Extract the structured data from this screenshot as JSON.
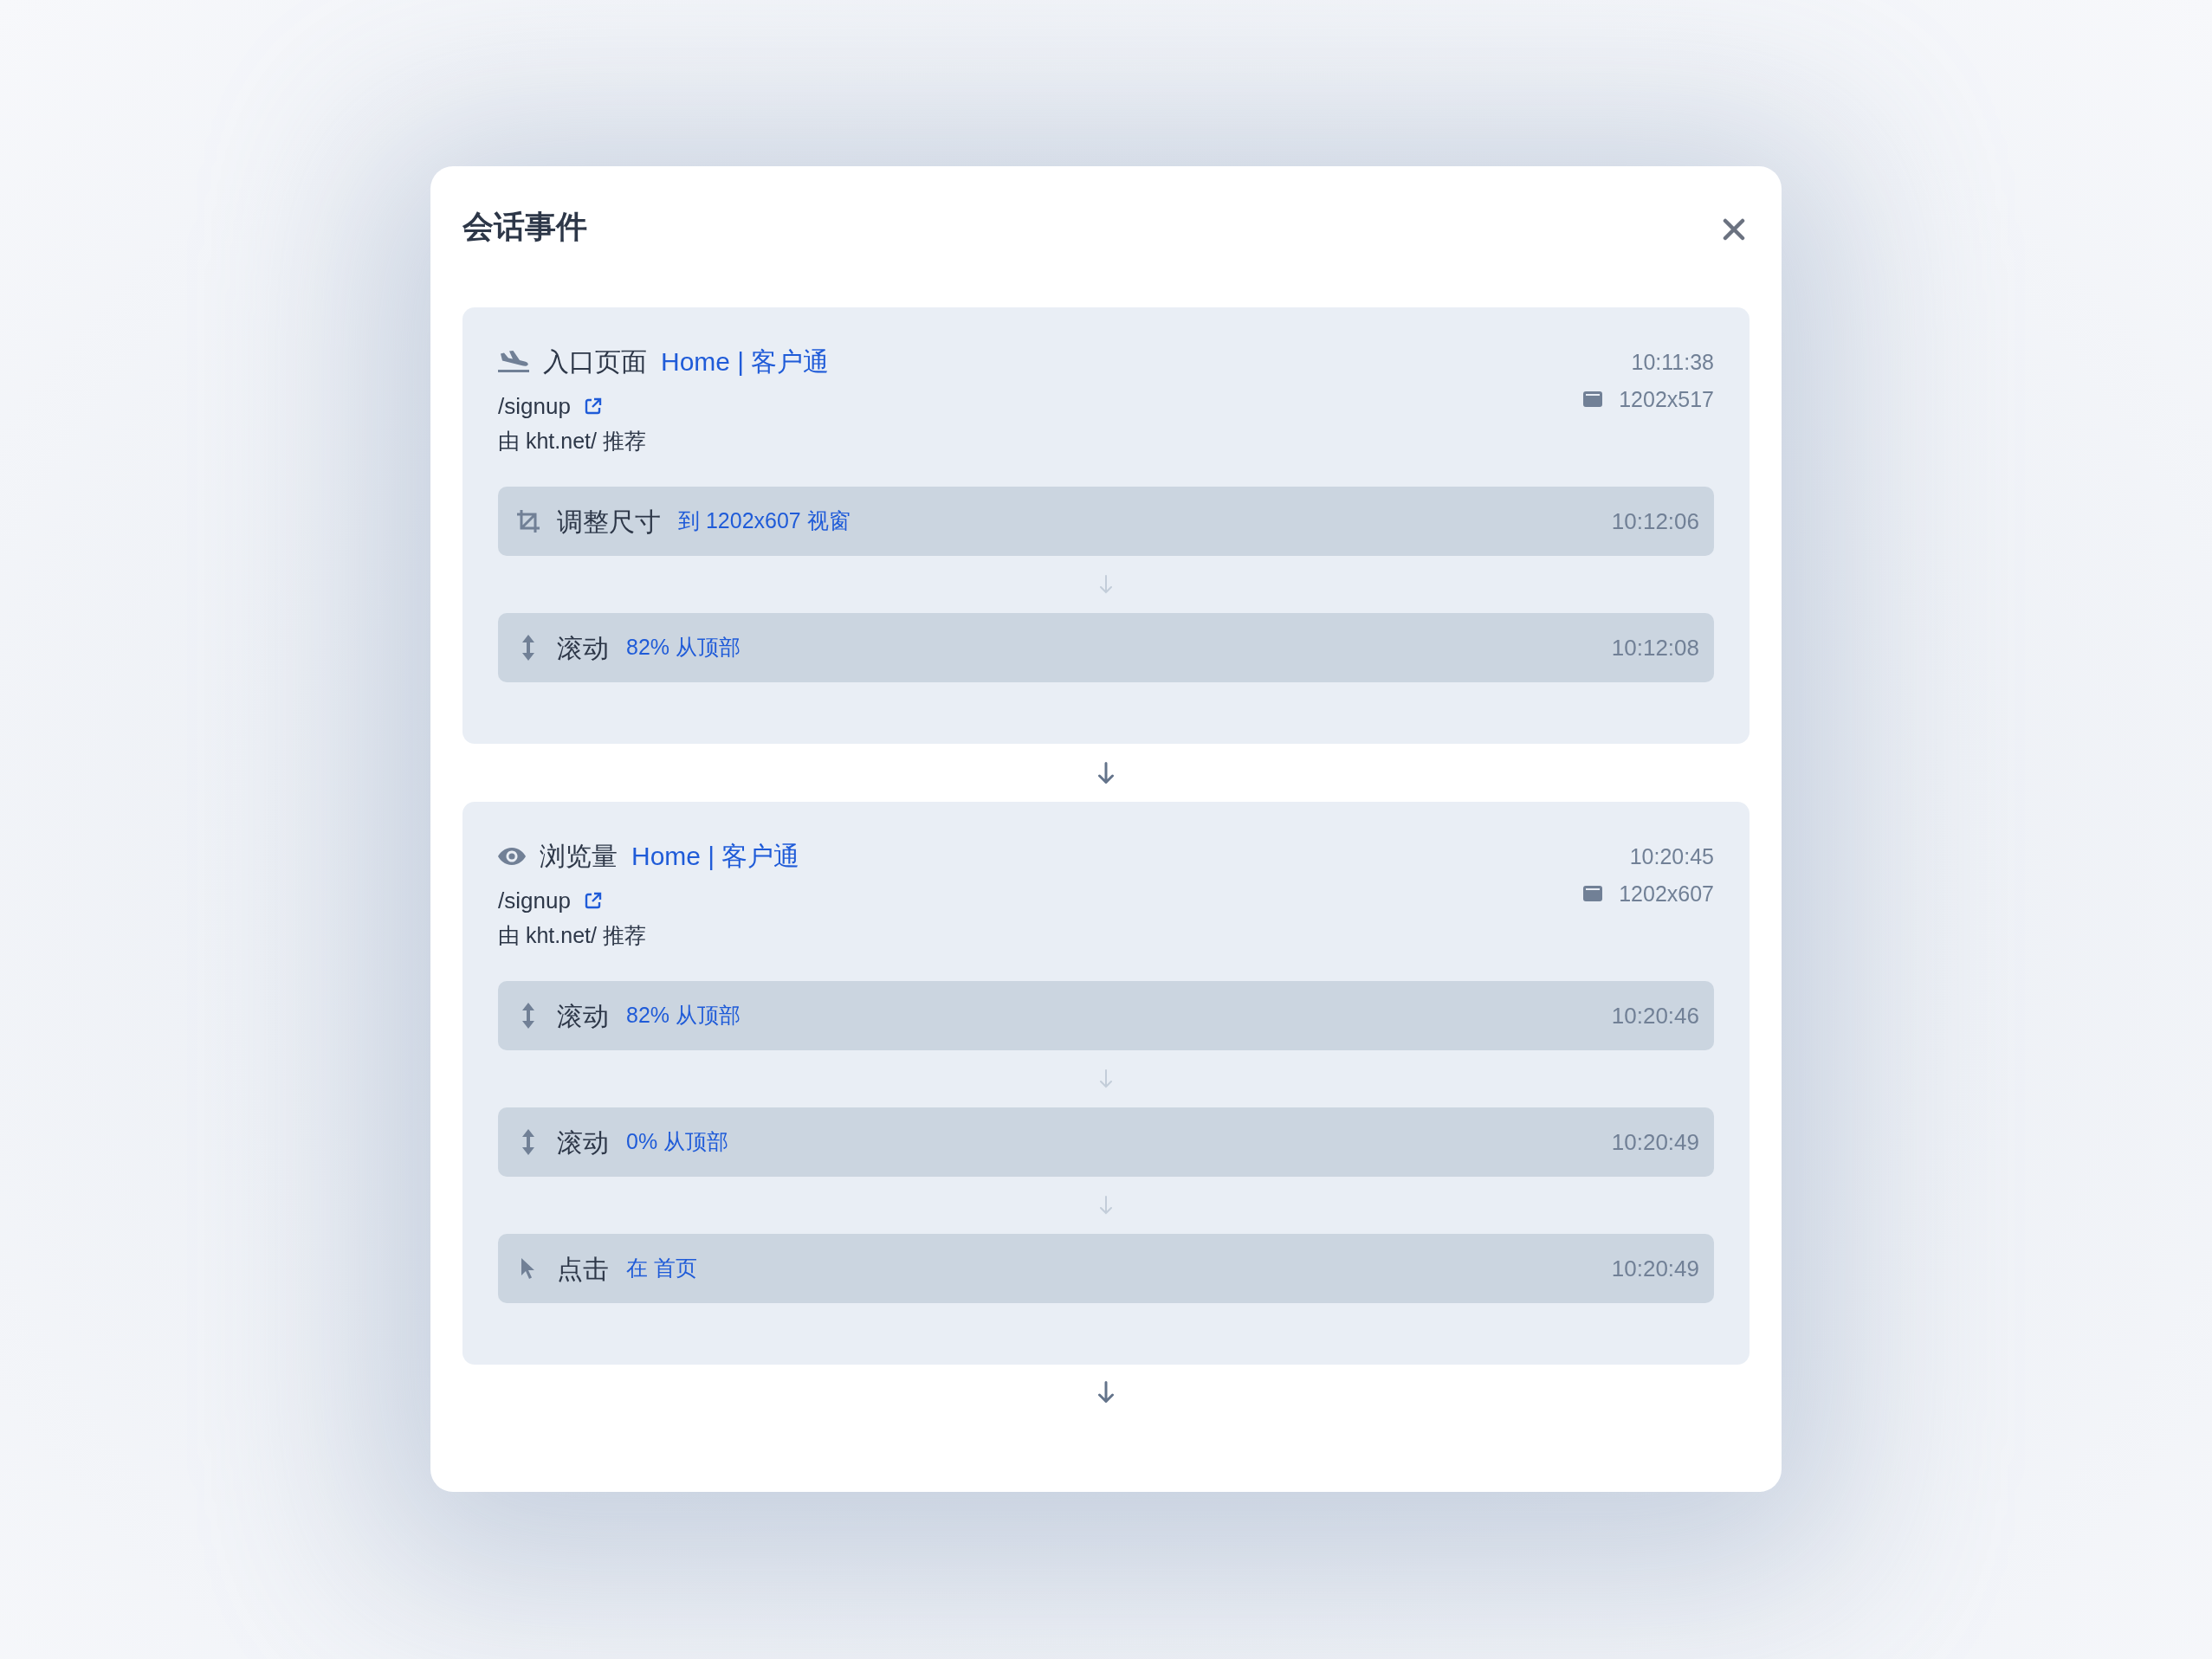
{
  "modal": {
    "title": "会话事件"
  },
  "visits": [
    {
      "kind": "entry",
      "label": "入口页面",
      "page_title": "Home | 客户通",
      "path": "/signup",
      "referrer": "由 kht.net/ 推荐",
      "time": "10:11:38",
      "viewport": "1202x517",
      "events": [
        {
          "kind": "resize",
          "label": "调整尺寸",
          "detail": "到 1202x607 视窗",
          "time": "10:12:06"
        },
        {
          "kind": "scroll",
          "label": "滚动",
          "detail": "82% 从顶部",
          "time": "10:12:08"
        }
      ]
    },
    {
      "kind": "pageview",
      "label": "浏览量",
      "page_title": "Home | 客户通",
      "path": "/signup",
      "referrer": "由 kht.net/ 推荐",
      "time": "10:20:45",
      "viewport": "1202x607",
      "events": [
        {
          "kind": "scroll",
          "label": "滚动",
          "detail": "82% 从顶部",
          "time": "10:20:46"
        },
        {
          "kind": "scroll",
          "label": "滚动",
          "detail": "0% 从顶部",
          "time": "10:20:49"
        },
        {
          "kind": "click",
          "label": "点击",
          "detail": "在 首页",
          "time": "10:20:49"
        }
      ]
    }
  ]
}
